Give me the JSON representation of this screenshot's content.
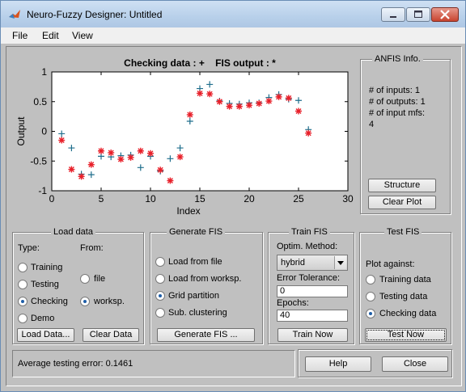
{
  "window": {
    "title": "Neuro-Fuzzy Designer: Untitled"
  },
  "menu": [
    "File",
    "Edit",
    "View"
  ],
  "plot": {
    "title": "Checking data : +    FIS output : *",
    "xlabel": "Index",
    "ylabel": "Output",
    "yticks": [
      "1",
      "0.5",
      "0",
      "-0.5",
      "-1"
    ],
    "xticks": [
      "0",
      "5",
      "10",
      "15",
      "20",
      "25",
      "30"
    ]
  },
  "chart_data": {
    "type": "scatter",
    "title": "Checking data : +    FIS output : *",
    "xlabel": "Index",
    "ylabel": "Output",
    "xlim": [
      0,
      30
    ],
    "ylim": [
      -1,
      1
    ],
    "series": [
      {
        "name": "Checking data",
        "marker": "+",
        "color": "#1f6e8c",
        "x": [
          1,
          2,
          3,
          4,
          5,
          6,
          7,
          8,
          9,
          10,
          11,
          12,
          13,
          14,
          15,
          16,
          17,
          18,
          19,
          20,
          21,
          22,
          23,
          24,
          25,
          26
        ],
        "y": [
          -0.04,
          -0.28,
          -0.72,
          -0.73,
          -0.42,
          -0.43,
          -0.41,
          -0.4,
          -0.61,
          -0.42,
          -0.67,
          -0.46,
          -0.28,
          0.17,
          0.72,
          0.79,
          0.51,
          0.47,
          0.46,
          0.48,
          0.48,
          0.57,
          0.62,
          0.54,
          0.52,
          0.03
        ]
      },
      {
        "name": "FIS output",
        "marker": "*",
        "color": "#e8202a",
        "x": [
          1,
          2,
          3,
          4,
          5,
          6,
          7,
          8,
          9,
          10,
          11,
          12,
          13,
          14,
          15,
          16,
          17,
          18,
          19,
          20,
          21,
          22,
          23,
          24,
          25,
          26
        ],
        "y": [
          -0.15,
          -0.64,
          -0.76,
          -0.56,
          -0.33,
          -0.36,
          -0.47,
          -0.44,
          -0.33,
          -0.37,
          -0.65,
          -0.83,
          -0.43,
          0.28,
          0.64,
          0.63,
          0.5,
          0.42,
          0.42,
          0.44,
          0.47,
          0.51,
          0.58,
          0.56,
          0.34,
          -0.03
        ]
      }
    ]
  },
  "anfis_info": {
    "title": "ANFIS Info.",
    "lines": [
      "# of inputs: 1",
      "# of outputs: 1",
      "# of input mfs:",
      "4"
    ],
    "structure_button": "Structure",
    "clear_plot_button": "Clear Plot"
  },
  "load_data": {
    "title": "Load data",
    "type_label": "Type:",
    "from_label": "From:",
    "types": [
      "Training",
      "Testing",
      "Checking",
      "Demo"
    ],
    "selected_type": "Checking",
    "sources": [
      "file",
      "worksp."
    ],
    "selected_source": "worksp.",
    "load_button": "Load Data...",
    "clear_button": "Clear Data"
  },
  "generate_fis": {
    "title": "Generate FIS",
    "options": [
      "Load from file",
      "Load from worksp.",
      "Grid partition",
      "Sub. clustering"
    ],
    "selected": "Grid partition",
    "button": "Generate FIS ..."
  },
  "train_fis": {
    "title": "Train FIS",
    "method_label": "Optim. Method:",
    "method_value": "hybrid",
    "tolerance_label": "Error Tolerance:",
    "tolerance_value": "0",
    "epochs_label": "Epochs:",
    "epochs_value": "40",
    "button": "Train Now"
  },
  "test_fis": {
    "title": "Test FIS",
    "plot_against_label": "Plot against:",
    "options": [
      "Training data",
      "Testing data",
      "Checking data"
    ],
    "selected": "Checking data",
    "button": "Test Now"
  },
  "status": {
    "text": "Average testing error: 0.1461"
  },
  "footer": {
    "help_button": "Help",
    "close_button": "Close"
  },
  "colors": {
    "titlebar": "#b8d0ea",
    "panel": "#c0c0c0",
    "checking_marker": "#1f6e8c",
    "fis_marker": "#e8202a"
  }
}
